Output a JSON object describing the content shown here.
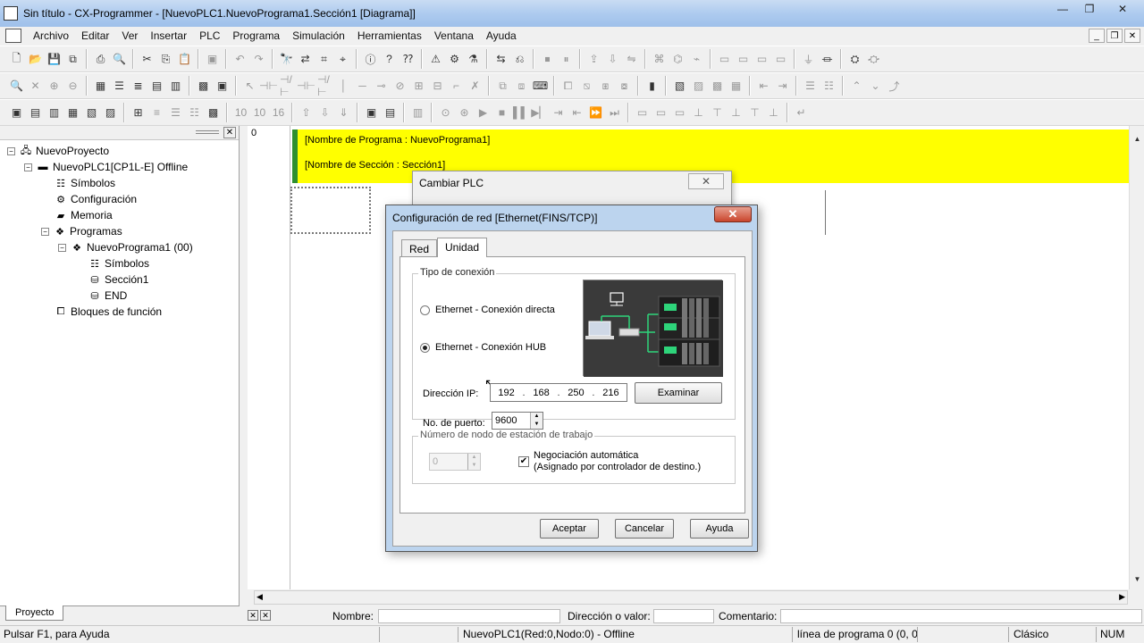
{
  "window": {
    "title": "Sin título - CX-Programmer - [NuevoPLC1.NuevoPrograma1.Sección1 [Diagrama]]",
    "minimize": "—",
    "maximize": "❐",
    "close": "✕"
  },
  "menu": {
    "items": [
      "Archivo",
      "Editar",
      "Ver",
      "Insertar",
      "PLC",
      "Programa",
      "Simulación",
      "Herramientas",
      "Ventana",
      "Ayuda"
    ]
  },
  "project_tree": {
    "nodes": [
      {
        "label": "NuevoProyecto",
        "icon": "network-icon"
      },
      {
        "label": "NuevoPLC1[CP1L-E] Offline",
        "icon": "plc-icon"
      },
      {
        "label": "Símbolos",
        "icon": "symbols-icon"
      },
      {
        "label": "Configuración",
        "icon": "settings-icon"
      },
      {
        "label": "Memoria",
        "icon": "memory-icon"
      },
      {
        "label": "Programas",
        "icon": "programs-icon"
      },
      {
        "label": "NuevoPrograma1 (00)",
        "icon": "program-icon"
      },
      {
        "label": "Símbolos",
        "icon": "symbols-icon"
      },
      {
        "label": "Sección1",
        "icon": "section-icon"
      },
      {
        "label": "END",
        "icon": "section-icon"
      },
      {
        "label": "Bloques de función",
        "icon": "function-block-icon"
      }
    ],
    "tab": "Proyecto"
  },
  "editor": {
    "rung_number": "0",
    "program_name": "[Nombre de Programa : NuevoPrograma1]",
    "section_name": "[Nombre de Sección : Sección1]"
  },
  "back_dialog": {
    "title": "Cambiar PLC"
  },
  "dialog": {
    "title": "Configuración de red [Ethernet(FINS/TCP)]",
    "tabs": [
      "Red",
      "Unidad"
    ],
    "active_tab": "Unidad",
    "connection_group": "Tipo de conexión",
    "radio_direct": "Ethernet - Conexión directa",
    "radio_hub": "Ethernet - Conexión HUB",
    "selected_radio": "radio_hub",
    "ip_label": "Dirección IP:",
    "ip": [
      "192",
      "168",
      "250",
      "216"
    ],
    "browse_button": "Examinar",
    "port_label": "No. de puerto:",
    "port_value": "9600",
    "node_group": "Número de nodo de estación de trabajo",
    "node_value": "0",
    "auto_negotiation_line1": "Negociación automática",
    "auto_negotiation_line2": "(Asignado por controlador de destino.)",
    "auto_negotiation_checked": true,
    "ok_button": "Aceptar",
    "cancel_button": "Cancelar",
    "help_button": "Ayuda"
  },
  "infobar": {
    "name_label": "Nombre:",
    "address_label": "Dirección o valor:",
    "comment_label": "Comentario:"
  },
  "statusbar": {
    "help": "Pulsar F1, para Ayuda",
    "plc_status": "NuevoPLC1(Red:0,Nodo:0) - Offline",
    "program_line": "línea de programa 0 (0, 0",
    "mode": "Clásico",
    "num": "NUM"
  },
  "colors": {
    "titlebar": "#aecbef",
    "header_band": "#ffff00",
    "rung_marker": "#2f8f2f",
    "dialog_frame": "#bcd4ee"
  }
}
